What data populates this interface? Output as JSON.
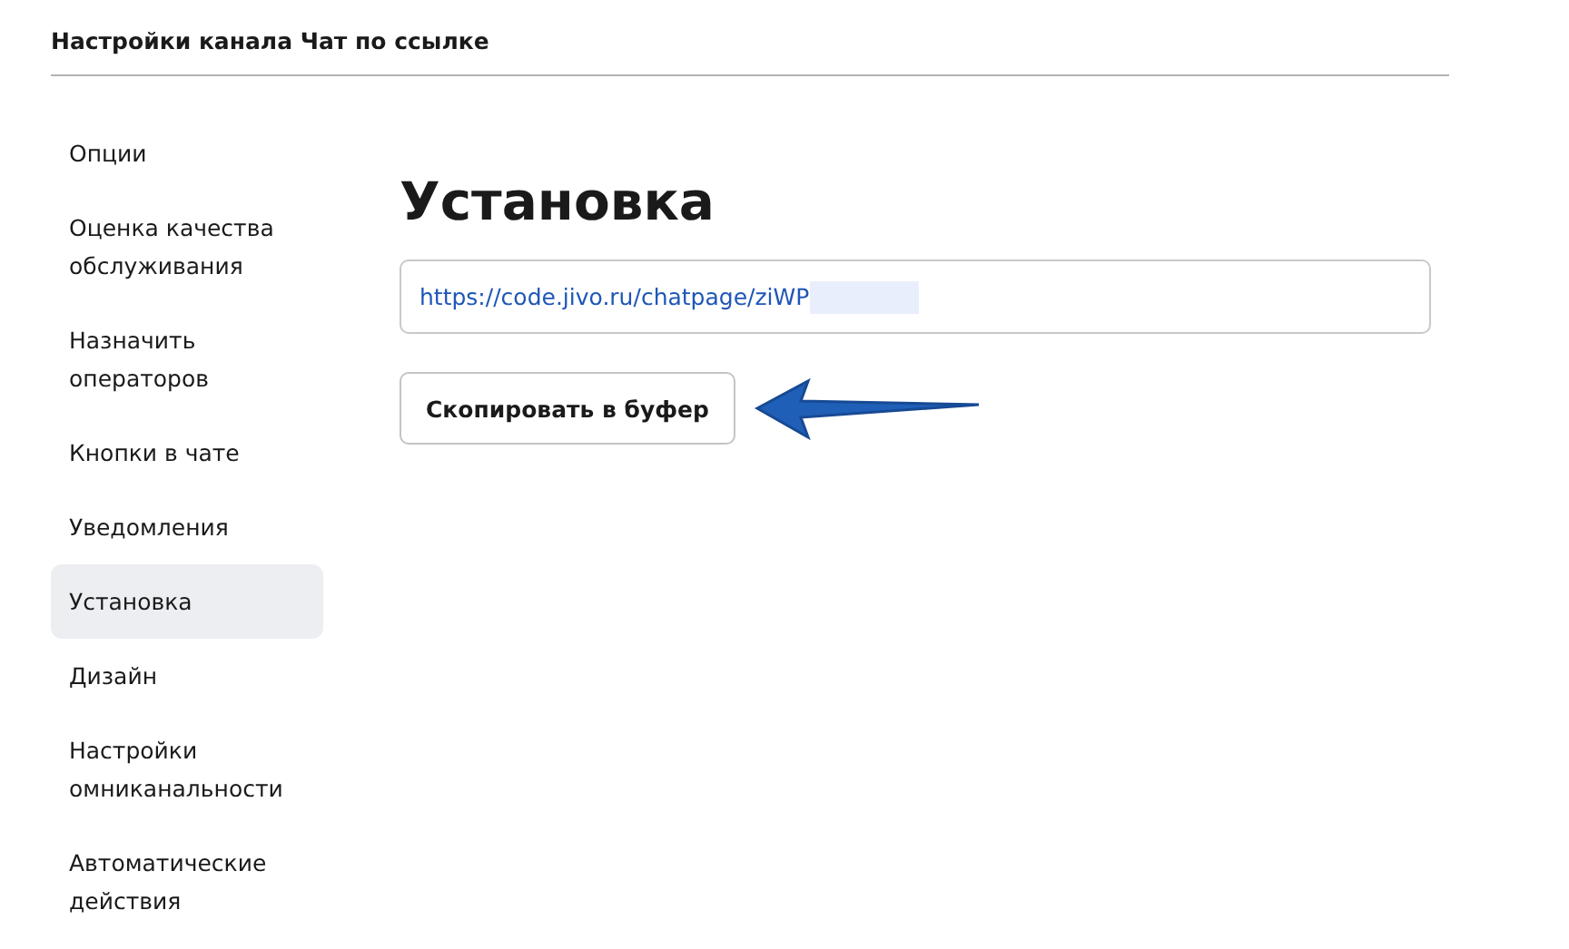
{
  "header": {
    "title": "Настройки канала Чат по ссылке"
  },
  "sidebar": {
    "items": [
      {
        "label": "Опции",
        "selected": false
      },
      {
        "label": "Оценка качества обслуживания",
        "selected": false
      },
      {
        "label": "Назначить операторов",
        "selected": false
      },
      {
        "label": "Кнопки в чате",
        "selected": false
      },
      {
        "label": "Уведомления",
        "selected": false
      },
      {
        "label": "Установка",
        "selected": true
      },
      {
        "label": "Дизайн",
        "selected": false
      },
      {
        "label": "Настройки омниканальности",
        "selected": false
      },
      {
        "label": "Автоматические действия",
        "selected": false
      }
    ]
  },
  "main": {
    "heading": "Установка",
    "link_field": {
      "value": "https://code.jivo.ru/chatpage/ziWP"
    },
    "copy_button": "Скопировать в буфер"
  }
}
